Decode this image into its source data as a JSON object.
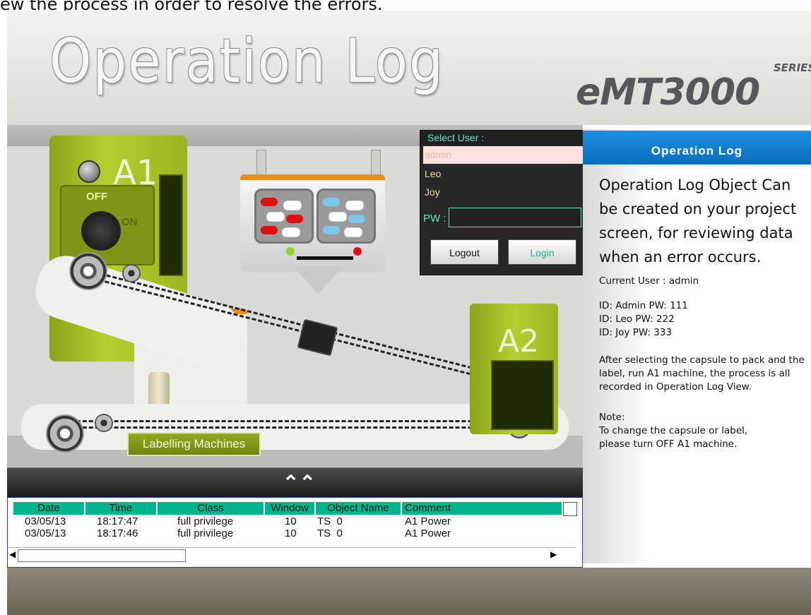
{
  "caption": "ew the process in order to resolve the errors.",
  "header": {
    "title": "Operation Log",
    "brand": "eMT3000",
    "brand_series": "SERIES"
  },
  "machines": {
    "a1_label": "A1",
    "a1_off": "OFF",
    "a1_on": "ON",
    "a2_label": "A2",
    "labelling_button": "Labelling Machines"
  },
  "login": {
    "header": "Select User :",
    "users": [
      "admin",
      "Leo",
      "Joy"
    ],
    "pw_label": "PW :",
    "pw_value": "",
    "logout_label": "Logout",
    "login_label": "Login"
  },
  "info": {
    "title": "Operation Log",
    "lead": "Operation Log Object Can be created on your project screen, for reviewing data when an error occurs.",
    "current_user": "Current User :  admin",
    "credentials": "ID: Admin PW: 111\nID: Leo     PW: 222\nID: Joy     PW: 333",
    "description": "After selecting the capsule to pack and the label, run A1 machine, the process is all recorded in Operation Log View.",
    "note": "Note:\nTo change the capsule or label,\nplease turn OFF A1 machine."
  },
  "log_table": {
    "columns": [
      "Date",
      "Time",
      "Class",
      "Window",
      "Object Name",
      "Comment"
    ],
    "rows": [
      [
        "03/05/13",
        "18:17:47",
        "full privilege",
        "10",
        "TS  0",
        "A1 Power"
      ],
      [
        "03/05/13",
        "18:17:46",
        "full privilege",
        "10",
        "TS  0",
        "A1 Power"
      ]
    ]
  },
  "icons": {
    "collapse": "double-chevron-up-icon",
    "scroll_left": "triangle-left-icon",
    "scroll_right": "triangle-right-icon"
  },
  "colors": {
    "accent_green": "#00b58c",
    "header_blue": "#1e8fe0",
    "machine_green": "#9cb422"
  }
}
